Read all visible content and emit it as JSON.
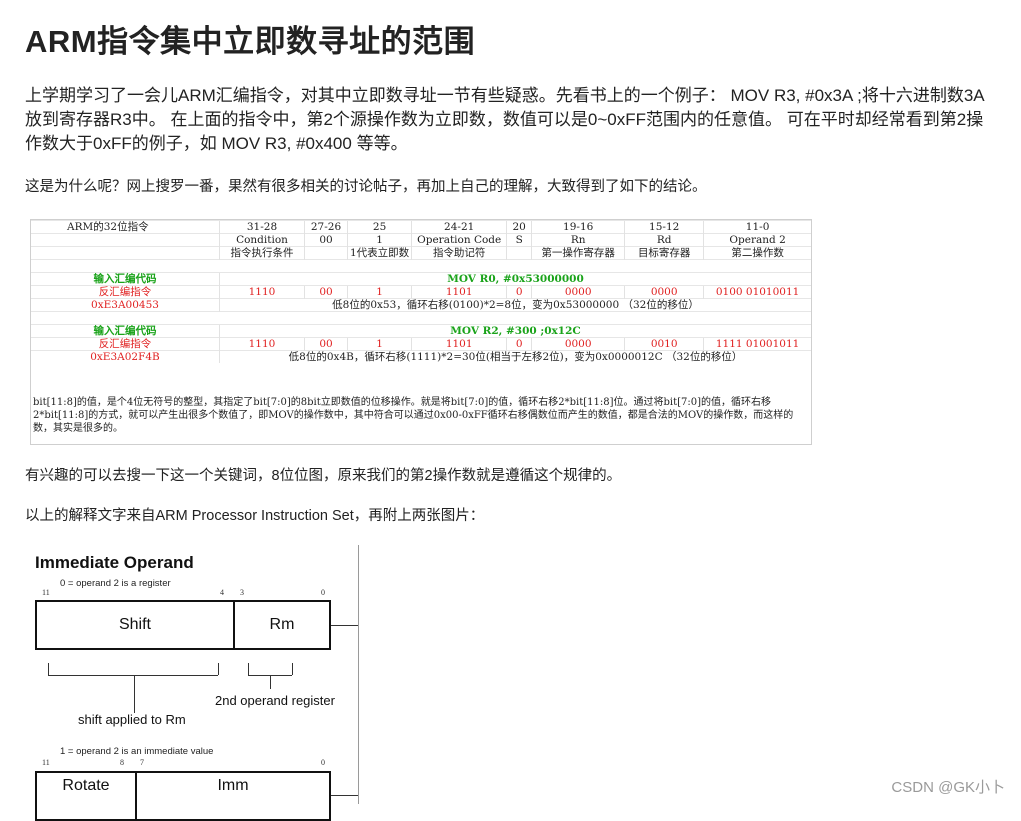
{
  "title": "ARM指令集中立即数寻址的范围",
  "paragraphs": {
    "p1": "上学期学习了一会儿ARM汇编指令，对其中立即数寻址一节有些疑惑。先看书上的一个例子： MOV R3, #0x3A ;将十六进制数3A放到寄存器R3中。 在上面的指令中，第2个源操作数为立即数，数值可以是0~0xFF范围内的任意值。 可在平时却经常看到第2操作数大于0xFF的例子，如 MOV R3, #0x400 等等。",
    "p2": "这是为什么呢？网上搜罗一番，果然有很多相关的讨论帖子，再加上自己的理解，大致得到了如下的结论。",
    "p3": "有兴趣的可以去搜一下这一个关键词，8位位图，原来我们的第2操作数就是遵循这个规律的。",
    "p4": "以上的解释文字来自ARM Processor Instruction Set，再附上两张图片："
  },
  "table_figure": {
    "header_row1": [
      "ARM的32位指令",
      "31-28",
      "27-26",
      "25",
      "24-21",
      "20",
      "19-16",
      "15-12",
      "11-0"
    ],
    "header_row2": [
      "",
      "Condition",
      "00",
      "1",
      "Operation Code",
      "S",
      "Rn",
      "Rd",
      "Operand 2"
    ],
    "header_row3": [
      "",
      "指令执行条件",
      "",
      "1代表立即数",
      "指令助记符",
      "",
      "第一操作寄存器",
      "目标寄存器",
      "第二操作数"
    ],
    "ex1": {
      "label_input": "输入汇编代码",
      "asm": "MOV R0, #0x53000000",
      "label_disasm": "反汇编指令",
      "fields": [
        "1110",
        "00",
        "1",
        "1101",
        "0",
        "0000",
        "0000",
        "0100 01010011"
      ],
      "hex": "0xE3A00453",
      "explain": "低8位的0x53，循环右移(0100)*2=8位，变为0x53000000 （32位的移位）"
    },
    "ex2": {
      "label_input": "输入汇编代码",
      "asm": "MOV R2, #300 ;0x12C",
      "label_disasm": "反汇编指令",
      "fields": [
        "1110",
        "00",
        "1",
        "1101",
        "0",
        "0000",
        "0010",
        "1111 01001011"
      ],
      "hex": "0xE3A02F4B",
      "explain": "低8位的0x4B，循环右移(1111)*2=30位(相当于左移2位)，变为0x0000012C （32位的移位）"
    },
    "note": "bit[11:8]的值，是个4位无符号的整型，其指定了bit[7:0]的8bit立即数值的位移操作。就是将bit[7:0]的值，循环右移2*bit[11:8]位。通过将bit[7:0]的值，循环右移2*bit[11:8]的方式，就可以产生出很多个数值了，即MOV的操作数中，其中符合可以通过0x00-0xFF循环右移偶数位而产生的数值，都是合法的MOV的操作数，而这样的数，其实是很多的。"
  },
  "diagram_figure": {
    "title": "Immediate Operand",
    "note_register": "0 = operand 2 is a register",
    "note_immediate": "1 = operand 2 is an immediate value",
    "bits_top": [
      "11",
      "4",
      "3",
      "0"
    ],
    "bits_bottom": [
      "11",
      "8",
      "7",
      "0"
    ],
    "box_shift": "Shift",
    "box_rm": "Rm",
    "box_rotate": "Rotate",
    "box_imm": "Imm",
    "label_shift": "shift applied to Rm",
    "label_rm": "2nd operand register"
  },
  "watermark": "CSDN @GK小卜"
}
